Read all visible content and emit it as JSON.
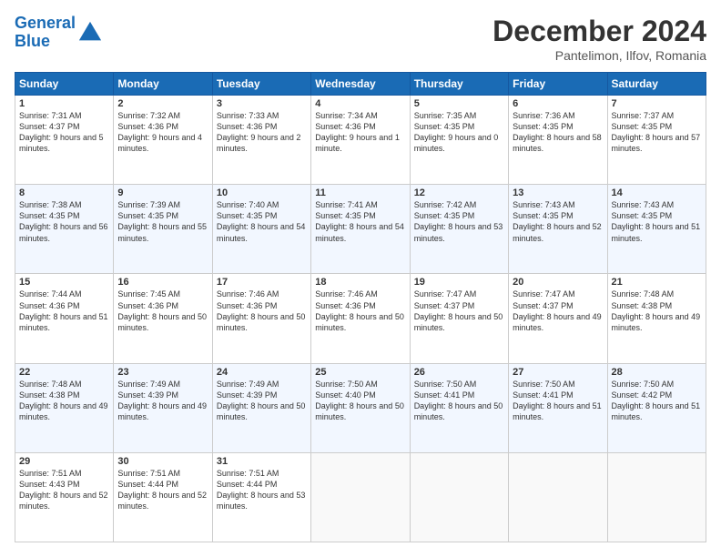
{
  "header": {
    "logo_line1": "General",
    "logo_line2": "Blue",
    "month": "December 2024",
    "location": "Pantelimon, Ilfov, Romania"
  },
  "weekdays": [
    "Sunday",
    "Monday",
    "Tuesday",
    "Wednesday",
    "Thursday",
    "Friday",
    "Saturday"
  ],
  "weeks": [
    [
      {
        "day": "1",
        "sunrise": "Sunrise: 7:31 AM",
        "sunset": "Sunset: 4:37 PM",
        "daylight": "Daylight: 9 hours and 5 minutes."
      },
      {
        "day": "2",
        "sunrise": "Sunrise: 7:32 AM",
        "sunset": "Sunset: 4:36 PM",
        "daylight": "Daylight: 9 hours and 4 minutes."
      },
      {
        "day": "3",
        "sunrise": "Sunrise: 7:33 AM",
        "sunset": "Sunset: 4:36 PM",
        "daylight": "Daylight: 9 hours and 2 minutes."
      },
      {
        "day": "4",
        "sunrise": "Sunrise: 7:34 AM",
        "sunset": "Sunset: 4:36 PM",
        "daylight": "Daylight: 9 hours and 1 minute."
      },
      {
        "day": "5",
        "sunrise": "Sunrise: 7:35 AM",
        "sunset": "Sunset: 4:35 PM",
        "daylight": "Daylight: 9 hours and 0 minutes."
      },
      {
        "day": "6",
        "sunrise": "Sunrise: 7:36 AM",
        "sunset": "Sunset: 4:35 PM",
        "daylight": "Daylight: 8 hours and 58 minutes."
      },
      {
        "day": "7",
        "sunrise": "Sunrise: 7:37 AM",
        "sunset": "Sunset: 4:35 PM",
        "daylight": "Daylight: 8 hours and 57 minutes."
      }
    ],
    [
      {
        "day": "8",
        "sunrise": "Sunrise: 7:38 AM",
        "sunset": "Sunset: 4:35 PM",
        "daylight": "Daylight: 8 hours and 56 minutes."
      },
      {
        "day": "9",
        "sunrise": "Sunrise: 7:39 AM",
        "sunset": "Sunset: 4:35 PM",
        "daylight": "Daylight: 8 hours and 55 minutes."
      },
      {
        "day": "10",
        "sunrise": "Sunrise: 7:40 AM",
        "sunset": "Sunset: 4:35 PM",
        "daylight": "Daylight: 8 hours and 54 minutes."
      },
      {
        "day": "11",
        "sunrise": "Sunrise: 7:41 AM",
        "sunset": "Sunset: 4:35 PM",
        "daylight": "Daylight: 8 hours and 54 minutes."
      },
      {
        "day": "12",
        "sunrise": "Sunrise: 7:42 AM",
        "sunset": "Sunset: 4:35 PM",
        "daylight": "Daylight: 8 hours and 53 minutes."
      },
      {
        "day": "13",
        "sunrise": "Sunrise: 7:43 AM",
        "sunset": "Sunset: 4:35 PM",
        "daylight": "Daylight: 8 hours and 52 minutes."
      },
      {
        "day": "14",
        "sunrise": "Sunrise: 7:43 AM",
        "sunset": "Sunset: 4:35 PM",
        "daylight": "Daylight: 8 hours and 51 minutes."
      }
    ],
    [
      {
        "day": "15",
        "sunrise": "Sunrise: 7:44 AM",
        "sunset": "Sunset: 4:36 PM",
        "daylight": "Daylight: 8 hours and 51 minutes."
      },
      {
        "day": "16",
        "sunrise": "Sunrise: 7:45 AM",
        "sunset": "Sunset: 4:36 PM",
        "daylight": "Daylight: 8 hours and 50 minutes."
      },
      {
        "day": "17",
        "sunrise": "Sunrise: 7:46 AM",
        "sunset": "Sunset: 4:36 PM",
        "daylight": "Daylight: 8 hours and 50 minutes."
      },
      {
        "day": "18",
        "sunrise": "Sunrise: 7:46 AM",
        "sunset": "Sunset: 4:36 PM",
        "daylight": "Daylight: 8 hours and 50 minutes."
      },
      {
        "day": "19",
        "sunrise": "Sunrise: 7:47 AM",
        "sunset": "Sunset: 4:37 PM",
        "daylight": "Daylight: 8 hours and 50 minutes."
      },
      {
        "day": "20",
        "sunrise": "Sunrise: 7:47 AM",
        "sunset": "Sunset: 4:37 PM",
        "daylight": "Daylight: 8 hours and 49 minutes."
      },
      {
        "day": "21",
        "sunrise": "Sunrise: 7:48 AM",
        "sunset": "Sunset: 4:38 PM",
        "daylight": "Daylight: 8 hours and 49 minutes."
      }
    ],
    [
      {
        "day": "22",
        "sunrise": "Sunrise: 7:48 AM",
        "sunset": "Sunset: 4:38 PM",
        "daylight": "Daylight: 8 hours and 49 minutes."
      },
      {
        "day": "23",
        "sunrise": "Sunrise: 7:49 AM",
        "sunset": "Sunset: 4:39 PM",
        "daylight": "Daylight: 8 hours and 49 minutes."
      },
      {
        "day": "24",
        "sunrise": "Sunrise: 7:49 AM",
        "sunset": "Sunset: 4:39 PM",
        "daylight": "Daylight: 8 hours and 50 minutes."
      },
      {
        "day": "25",
        "sunrise": "Sunrise: 7:50 AM",
        "sunset": "Sunset: 4:40 PM",
        "daylight": "Daylight: 8 hours and 50 minutes."
      },
      {
        "day": "26",
        "sunrise": "Sunrise: 7:50 AM",
        "sunset": "Sunset: 4:41 PM",
        "daylight": "Daylight: 8 hours and 50 minutes."
      },
      {
        "day": "27",
        "sunrise": "Sunrise: 7:50 AM",
        "sunset": "Sunset: 4:41 PM",
        "daylight": "Daylight: 8 hours and 51 minutes."
      },
      {
        "day": "28",
        "sunrise": "Sunrise: 7:50 AM",
        "sunset": "Sunset: 4:42 PM",
        "daylight": "Daylight: 8 hours and 51 minutes."
      }
    ],
    [
      {
        "day": "29",
        "sunrise": "Sunrise: 7:51 AM",
        "sunset": "Sunset: 4:43 PM",
        "daylight": "Daylight: 8 hours and 52 minutes."
      },
      {
        "day": "30",
        "sunrise": "Sunrise: 7:51 AM",
        "sunset": "Sunset: 4:44 PM",
        "daylight": "Daylight: 8 hours and 52 minutes."
      },
      {
        "day": "31",
        "sunrise": "Sunrise: 7:51 AM",
        "sunset": "Sunset: 4:44 PM",
        "daylight": "Daylight: 8 hours and 53 minutes."
      },
      null,
      null,
      null,
      null
    ]
  ]
}
